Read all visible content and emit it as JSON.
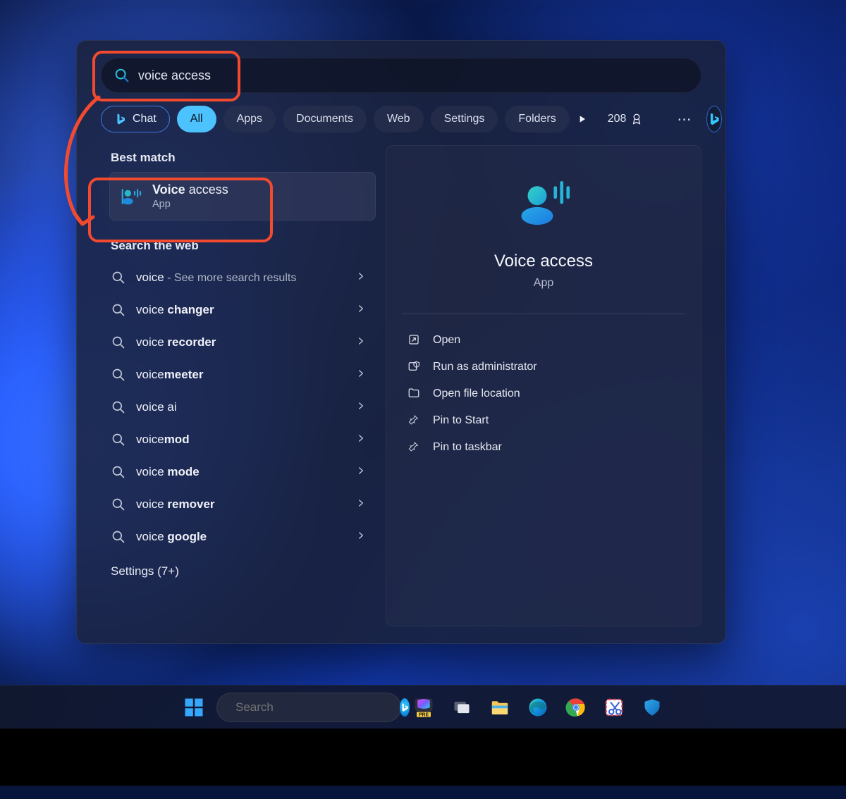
{
  "search": {
    "query": "voice access"
  },
  "filters": {
    "chat": "Chat",
    "all": "All",
    "apps": "Apps",
    "documents": "Documents",
    "web": "Web",
    "settings": "Settings",
    "folders": "Folders"
  },
  "rewards": {
    "points": "208"
  },
  "left": {
    "best_match_label": "Best match",
    "best_match": {
      "title_bold": "Voice",
      "title_rest": " access",
      "subtitle": "App"
    },
    "search_web_label": "Search the web",
    "web_results": [
      {
        "prefix": "voice",
        "bold": "",
        "suffix": " - See more search results",
        "subStyle": true
      },
      {
        "prefix": "voice ",
        "bold": "changer",
        "suffix": ""
      },
      {
        "prefix": "voice ",
        "bold": "recorder",
        "suffix": ""
      },
      {
        "prefix": "voice",
        "bold": "meeter",
        "suffix": ""
      },
      {
        "prefix": "voice ai",
        "bold": "",
        "suffix": ""
      },
      {
        "prefix": "voice",
        "bold": "mod",
        "suffix": ""
      },
      {
        "prefix": "voice ",
        "bold": "mode",
        "suffix": ""
      },
      {
        "prefix": "voice ",
        "bold": "remover",
        "suffix": ""
      },
      {
        "prefix": "voice ",
        "bold": "google",
        "suffix": ""
      }
    ],
    "settings_more": "Settings (7+)"
  },
  "detail": {
    "title": "Voice access",
    "subtitle": "App",
    "actions": {
      "open": "Open",
      "run_admin": "Run as administrator",
      "open_loc": "Open file location",
      "pin_start": "Pin to Start",
      "pin_taskbar": "Pin to taskbar"
    }
  },
  "taskbar": {
    "search_placeholder": "Search"
  }
}
